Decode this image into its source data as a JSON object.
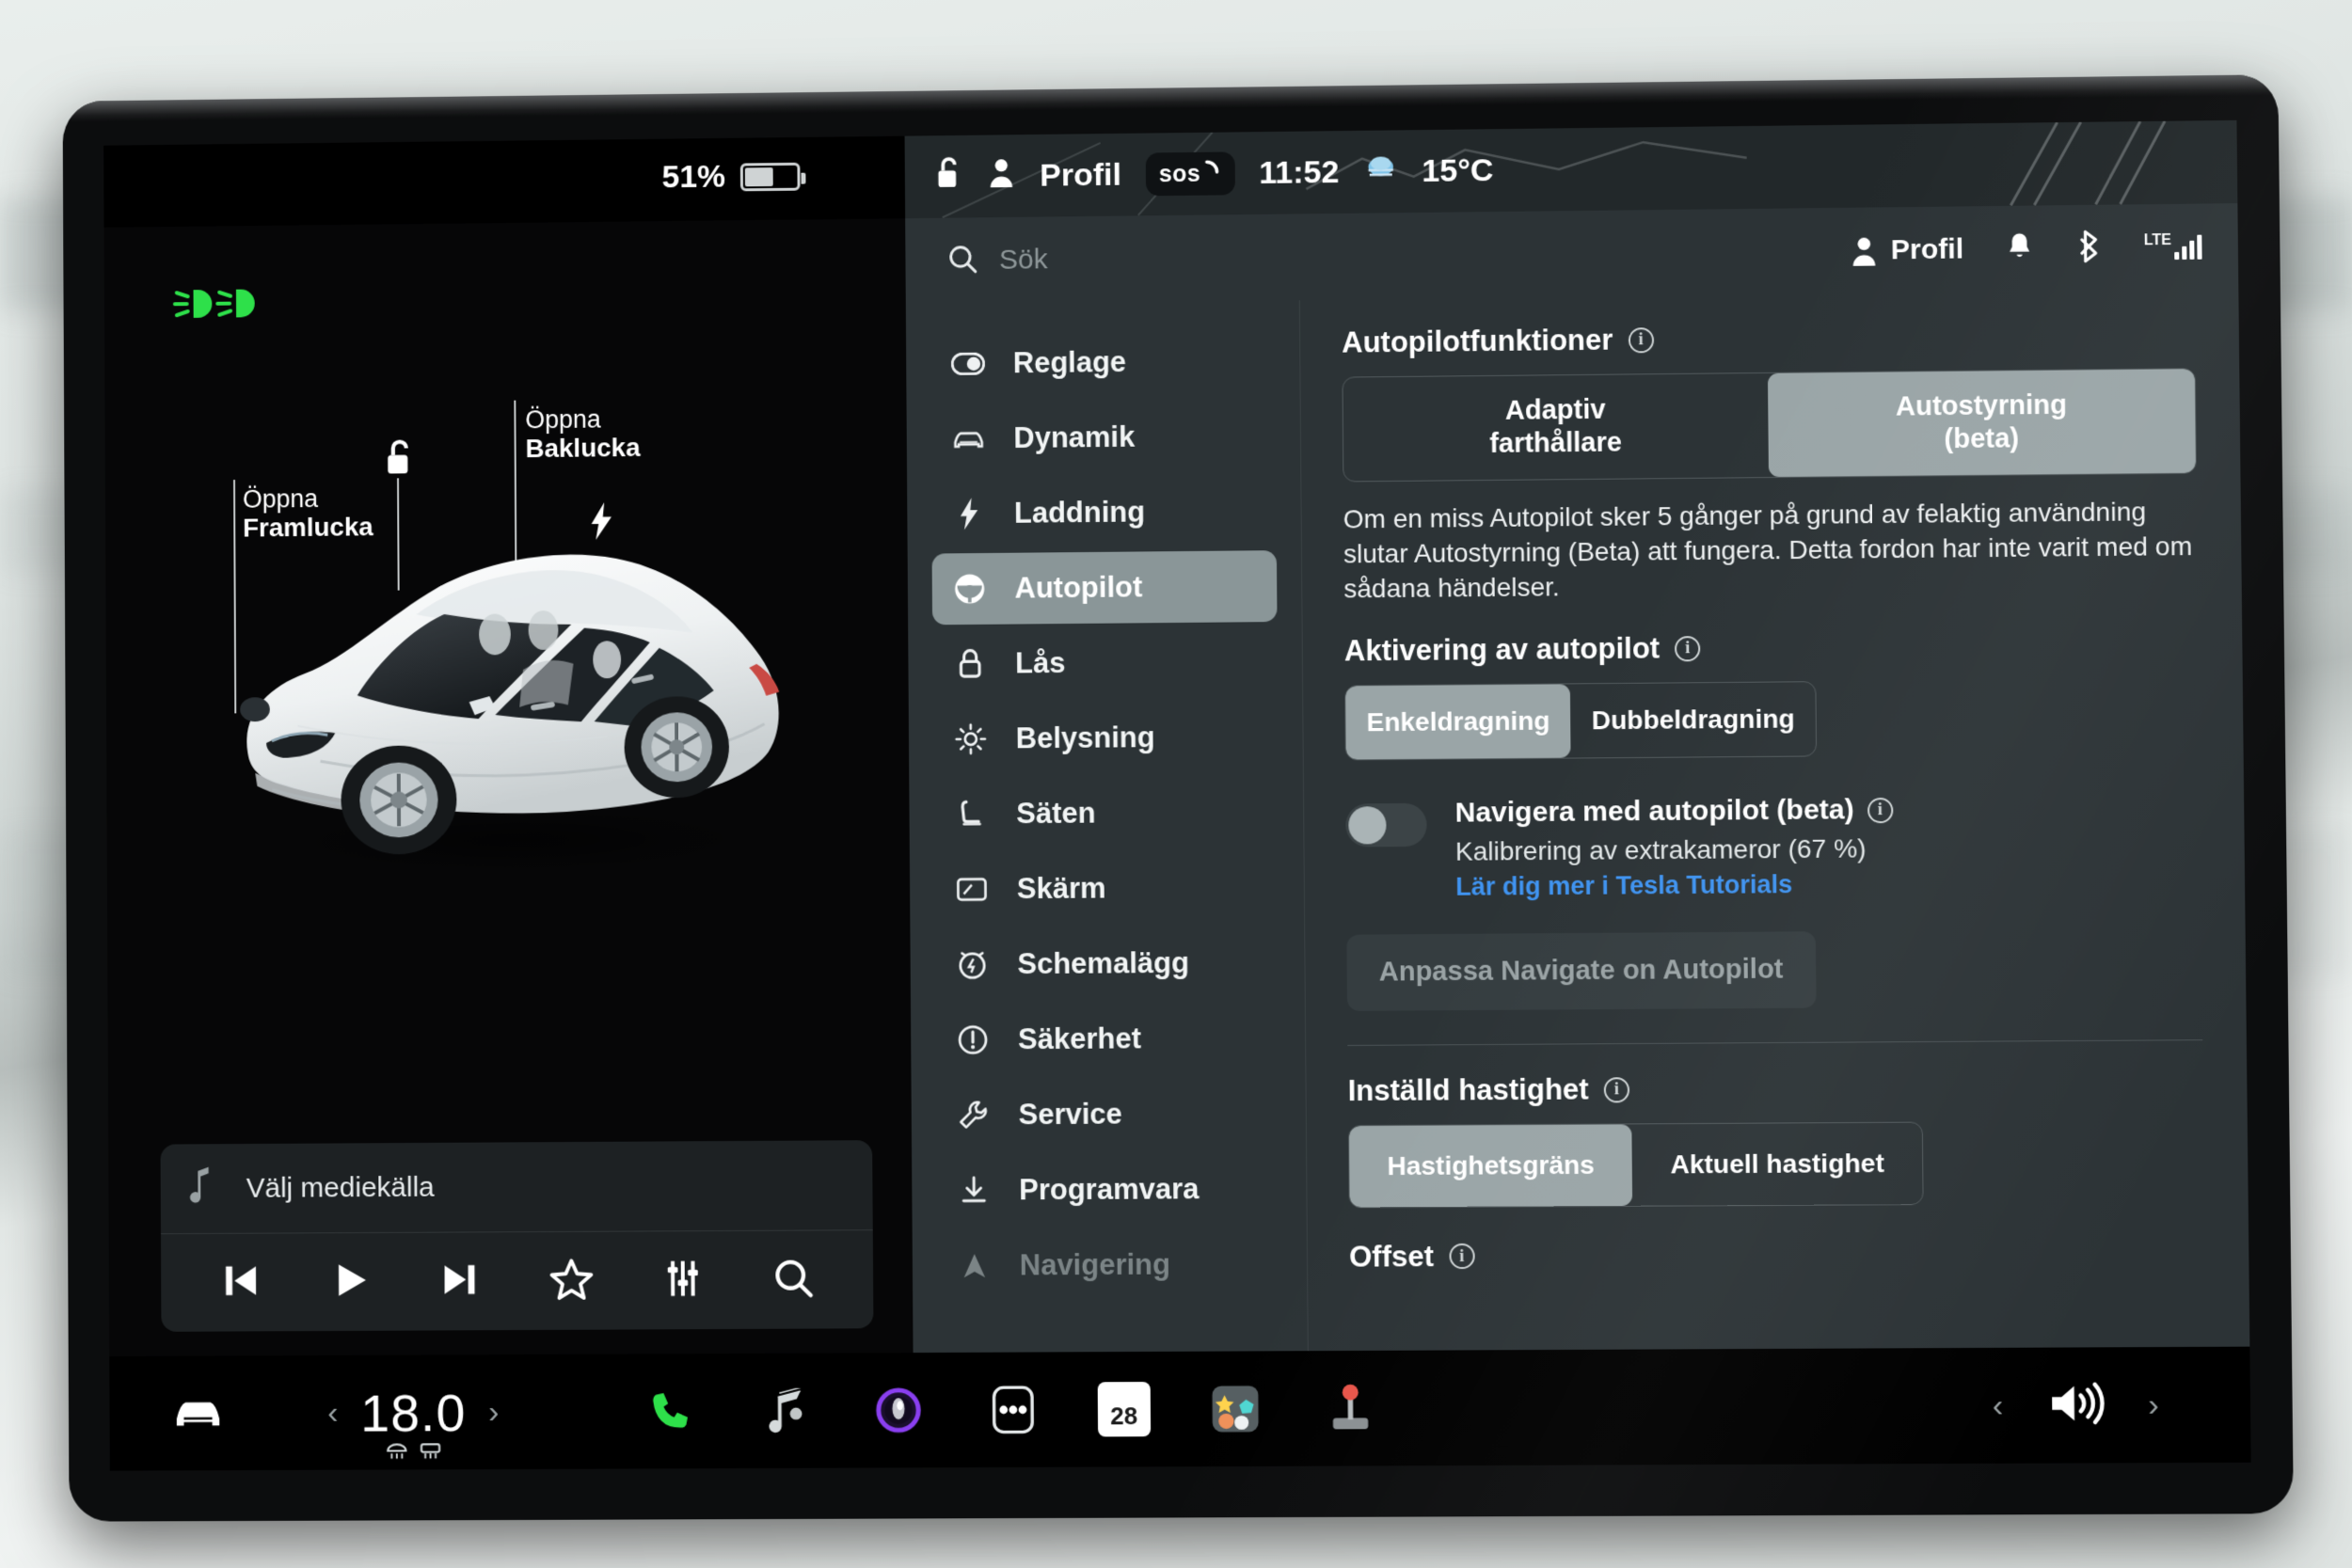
{
  "status_bar": {
    "battery_percent": "51%",
    "battery_level": 51,
    "lock_icon": "unlocked-padlock-icon",
    "profile_icon": "person-icon",
    "profile_label": "Profil",
    "sos_label": "sos",
    "time": "11:52",
    "weather_icon": "cloud-icon",
    "temperature": "15°C"
  },
  "left_pane": {
    "headlight_indicator": "headlight-low-beam-icon",
    "callout_front": {
      "line1": "Öppna",
      "line2": "Framlucka"
    },
    "callout_rear": {
      "line1": "Öppna",
      "line2": "Baklucka"
    },
    "lock_icon": "unlocked-padlock-icon",
    "charge_port_icon": "lightning-bolt-icon",
    "vehicle_image": "tesla-model-y-white-render"
  },
  "media_bar": {
    "note_icon": "music-note-icon",
    "title": "Välj mediekälla",
    "controls": [
      {
        "name": "previous-track-button",
        "icon": "skip-back-icon"
      },
      {
        "name": "play-button",
        "icon": "play-icon"
      },
      {
        "name": "next-track-button",
        "icon": "skip-forward-icon"
      },
      {
        "name": "favorite-button",
        "icon": "star-icon"
      },
      {
        "name": "equalizer-button",
        "icon": "sliders-icon"
      },
      {
        "name": "media-search-button",
        "icon": "search-icon"
      }
    ]
  },
  "search": {
    "icon": "search-icon",
    "placeholder": "Sök",
    "value": ""
  },
  "top_right": {
    "profile_icon": "person-icon",
    "profile_label": "Profil",
    "notifications_icon": "bell-icon",
    "bluetooth_icon": "bluetooth-icon",
    "network_label": "LTE",
    "signal_icon": "signal-bars-icon",
    "signal_bars": 4
  },
  "sidebar": {
    "items": [
      {
        "label": "Reglage",
        "icon": "toggle-switch-icon",
        "state": "normal"
      },
      {
        "label": "Dynamik",
        "icon": "car-front-icon",
        "state": "normal"
      },
      {
        "label": "Laddning",
        "icon": "lightning-bolt-icon",
        "state": "normal"
      },
      {
        "label": "Autopilot",
        "icon": "steering-wheel-icon",
        "state": "active"
      },
      {
        "label": "Lås",
        "icon": "padlock-icon",
        "state": "normal"
      },
      {
        "label": "Belysning",
        "icon": "sun-icon",
        "state": "normal"
      },
      {
        "label": "Säten",
        "icon": "car-seat-icon",
        "state": "normal"
      },
      {
        "label": "Skärm",
        "icon": "display-icon",
        "state": "normal"
      },
      {
        "label": "Schemalägg",
        "icon": "alarm-clock-icon",
        "state": "normal"
      },
      {
        "label": "Säkerhet",
        "icon": "warning-circle-icon",
        "state": "normal"
      },
      {
        "label": "Service",
        "icon": "wrench-icon",
        "state": "normal"
      },
      {
        "label": "Programvara",
        "icon": "download-icon",
        "state": "normal"
      },
      {
        "label": "Navigering",
        "icon": "navigation-arrow-icon",
        "state": "dim"
      }
    ]
  },
  "content": {
    "autopilot_features": {
      "heading": "Autopilotfunktioner",
      "info_icon": "info-icon",
      "options": [
        {
          "label_line1": "Adaptiv",
          "label_line2": "farthållare",
          "selected": false
        },
        {
          "label_line1": "Autostyrning",
          "label_line2": "(beta)",
          "selected": true
        }
      ],
      "description": "Om en miss Autopilot sker 5 gånger på grund av felaktig användning slutar Autostyrning (Beta) att fungera. Detta fordon har inte varit med om sådana händelser."
    },
    "autopilot_activation": {
      "heading": "Aktivering av autopilot",
      "info_icon": "info-icon",
      "options": [
        {
          "label": "Enkeldragning",
          "selected": true
        },
        {
          "label": "Dubbeldragning",
          "selected": false
        }
      ]
    },
    "navigate_on_autopilot": {
      "toggle_state": "off",
      "title": "Navigera med autopilot (beta)",
      "info_icon": "info-icon",
      "subtitle": "Kalibrering av extrakameror (67 %)",
      "link": "Lär dig mer i Tesla Tutorials",
      "button": "Anpassa Navigate on Autopilot",
      "button_enabled": false
    },
    "set_speed": {
      "heading": "Inställd hastighet",
      "info_icon": "info-icon",
      "options": [
        {
          "label": "Hastighetsgräns",
          "selected": true
        },
        {
          "label": "Aktuell hastighet",
          "selected": false
        }
      ]
    },
    "offset": {
      "heading": "Offset",
      "info_icon": "info-icon"
    }
  },
  "taskbar": {
    "car_icon": "car-front-icon",
    "temp_left_chevron": "chevron-left-icon",
    "temperature": "18.0",
    "temp_right_chevron": "chevron-right-icon",
    "defrost_icons": [
      "defrost-front-icon",
      "defrost-rear-icon"
    ],
    "apps": [
      {
        "name": "phone-app-icon",
        "icon": "phone-icon",
        "color": "#2ee04a"
      },
      {
        "name": "media-app-icon",
        "icon": "music-note-icon",
        "color": "#d5dadb"
      },
      {
        "name": "camera-app-icon",
        "icon": "lens-icon",
        "color": "#8a3ff0"
      },
      {
        "name": "apps-menu-icon",
        "icon": "three-dots-icon",
        "color": "#ffffff"
      },
      {
        "name": "calendar-app-icon",
        "icon": "calendar-icon",
        "color": "#ffffff",
        "day": "28"
      },
      {
        "name": "toybox-app-icon",
        "icon": "toybox-icon",
        "color": "#ffd34d"
      },
      {
        "name": "joystick-app-icon",
        "icon": "joystick-icon",
        "color": "#e8554a"
      }
    ],
    "volume_left_chevron": "chevron-left-icon",
    "volume_icon": "speaker-volume-icon",
    "volume_right_chevron": "chevron-right-icon"
  },
  "colors": {
    "accent_link": "#3f93f0",
    "selected_segment": "#9aa5a7",
    "panel_bg": "#2c3336",
    "screen_bg": "#000000",
    "indicator_green": "#2ee04a"
  }
}
